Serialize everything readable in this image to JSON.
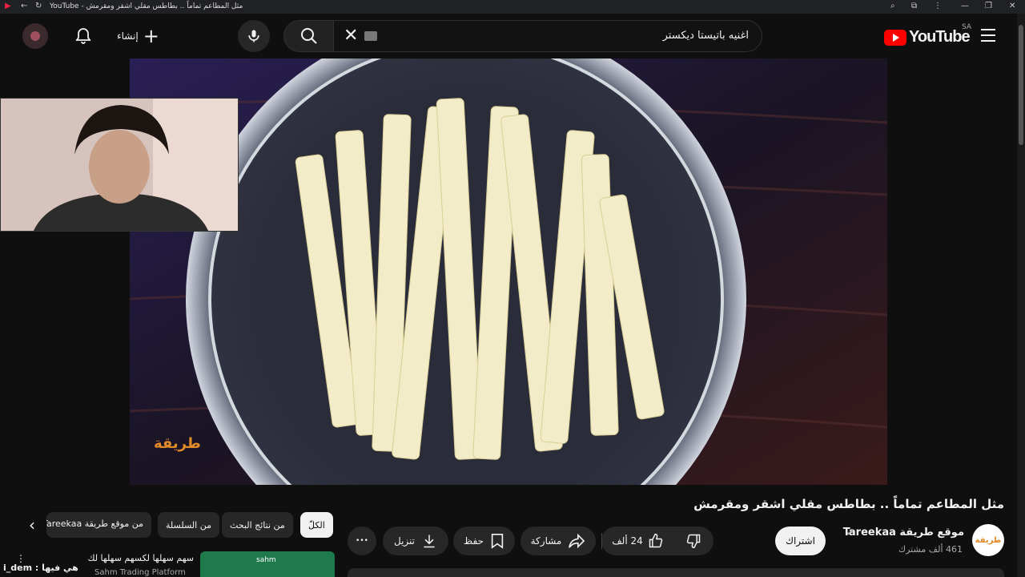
{
  "browser": {
    "tab_title": "مثل المطاعم تماماً .. بطاطس مقلي اشقر ومقرمش - YouTube"
  },
  "header": {
    "logo_text": "YouTube",
    "region": "SA",
    "search_value": "اغنيه باتيستا ديكستر",
    "create_label": "إنشاء"
  },
  "video": {
    "watermark": "طريقة"
  },
  "info": {
    "title": "مثل المطاعم تماماً .. بطاطس مقلي اشقر ومقرمش",
    "channel_name": "موقع طريقة Tareekaa",
    "subscribers": "461 ألف مشترك",
    "channel_avatar_text": "طريقة",
    "subscribe_label": "اشتراك",
    "likes": "24 ألف",
    "share_label": "مشاركة",
    "save_label": "حفظ",
    "download_label": "تنزيل",
    "more_label": "•••"
  },
  "chips": [
    "الكلّ",
    "من نتائج البحث",
    "من السلسلة",
    "من موقع طريقة Tareekaa"
  ],
  "recommendation": {
    "title": "سهم سهلها لكسهم سهلها لك",
    "channel": "Sahm Trading Platform",
    "thumb_brand": "sahm"
  },
  "overlay": {
    "text": "هي فيها : i_dem"
  },
  "colors": {
    "youtube_red": "#ff0000",
    "background": "#0f0f0f",
    "chip_bg": "#272727"
  }
}
